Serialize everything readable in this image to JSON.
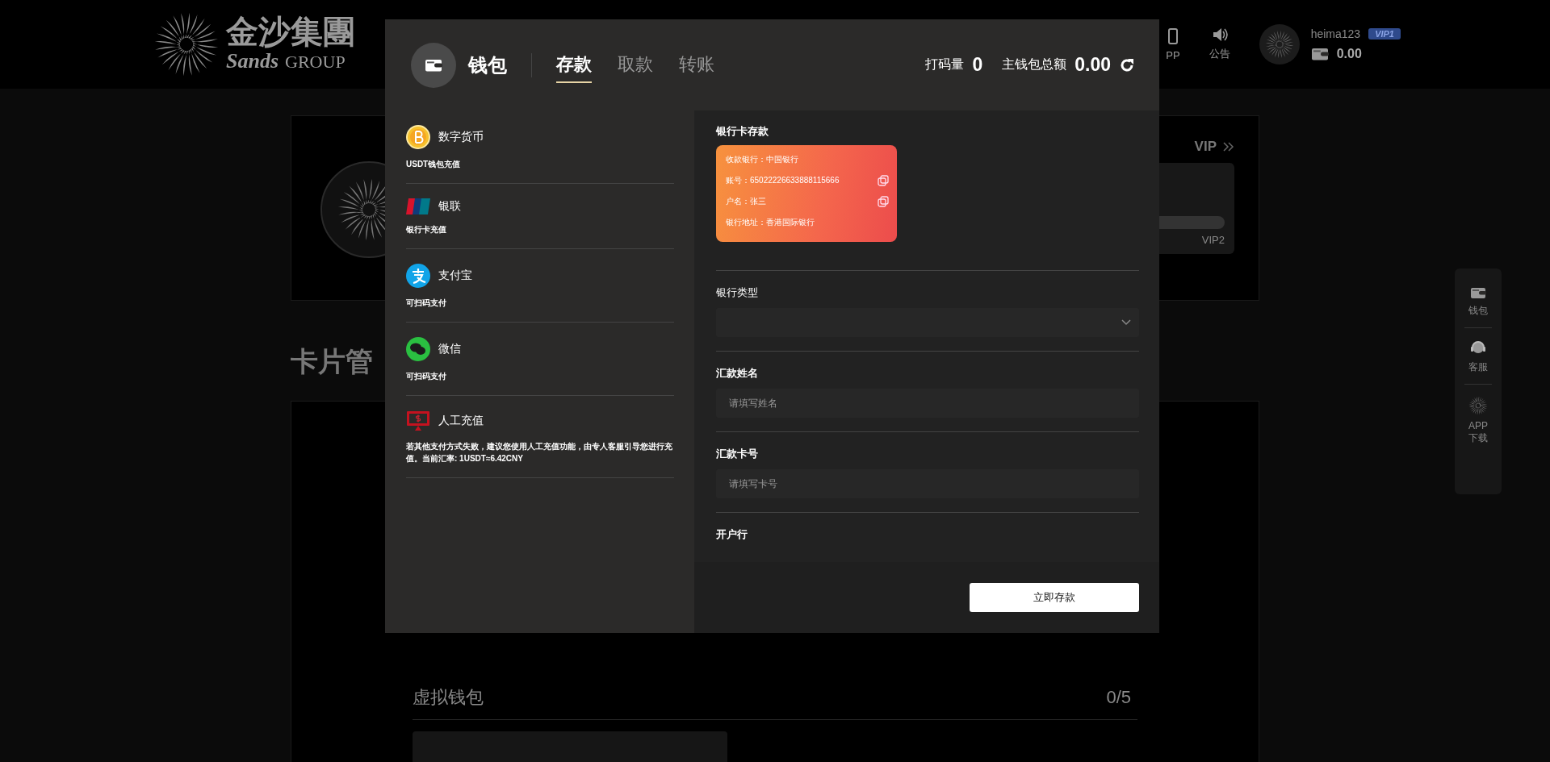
{
  "site_header": {
    "logo": {
      "title": "金沙集團",
      "brand": "Sands",
      "group": "GROUP"
    },
    "nav": [
      {
        "kind": "app",
        "label": "PP"
      },
      {
        "kind": "notice",
        "label": "公告"
      }
    ],
    "user": {
      "name": "heima123",
      "vip": "VIP1",
      "balance": "0.00"
    }
  },
  "profile_card": {
    "vip_label": "VIP",
    "next_level": "VIP2",
    "level": 0
  },
  "card_section": {
    "title": "卡片管",
    "virtual_wallet": {
      "title": "虚拟钱包",
      "count": "0/5"
    }
  },
  "float_menu": [
    {
      "kind": "wallet",
      "label": "钱包"
    },
    {
      "kind": "service",
      "label": "客服"
    },
    {
      "kind": "app",
      "label": "APP 下载"
    }
  ],
  "modal": {
    "title": "钱包",
    "tabs": [
      {
        "label": "存款",
        "selected": true
      },
      {
        "label": "取款",
        "selected": false
      },
      {
        "label": "转账",
        "selected": false
      }
    ],
    "stats": [
      {
        "label": "打码量",
        "value": "0",
        "refresh": false
      },
      {
        "label": "主钱包总额",
        "value": "0.00",
        "refresh": true
      }
    ],
    "methods": [
      {
        "kind": "crypto",
        "name": "数字货币",
        "desc": "USDT钱包充值"
      },
      {
        "kind": "unionpay",
        "name": "银联",
        "desc": "银行卡充值"
      },
      {
        "kind": "alipay",
        "name": "支付宝",
        "desc": "可扫码支付"
      },
      {
        "kind": "wechat",
        "name": "微信",
        "desc": "可扫码支付"
      },
      {
        "kind": "manual",
        "name": "人工充值",
        "desc": "若其他支付方式失败，建议您使用人工充值功能，由专人客服引导您进行充值。当前汇率: 1USDT≈6.42CNY"
      }
    ],
    "deposit": {
      "title": "银行卡存款",
      "bank_card": [
        {
          "text": "收款银行：中国银行",
          "copyable": false
        },
        {
          "text": "账号：6502222663388811​5666",
          "copyable": true
        },
        {
          "text": "户名：张三",
          "copyable": true
        },
        {
          "text": "银行地址：香港国际银行",
          "copyable": false
        }
      ],
      "fields": [
        {
          "kind": "select",
          "label": "银行类型"
        },
        {
          "kind": "text",
          "label": "汇款姓名",
          "placeholder": "请填写姓名"
        },
        {
          "kind": "text",
          "label": "汇款卡号",
          "placeholder": "请填写卡号"
        },
        {
          "kind": "heading",
          "label": "开户行"
        }
      ],
      "submit": "立即存款"
    }
  }
}
